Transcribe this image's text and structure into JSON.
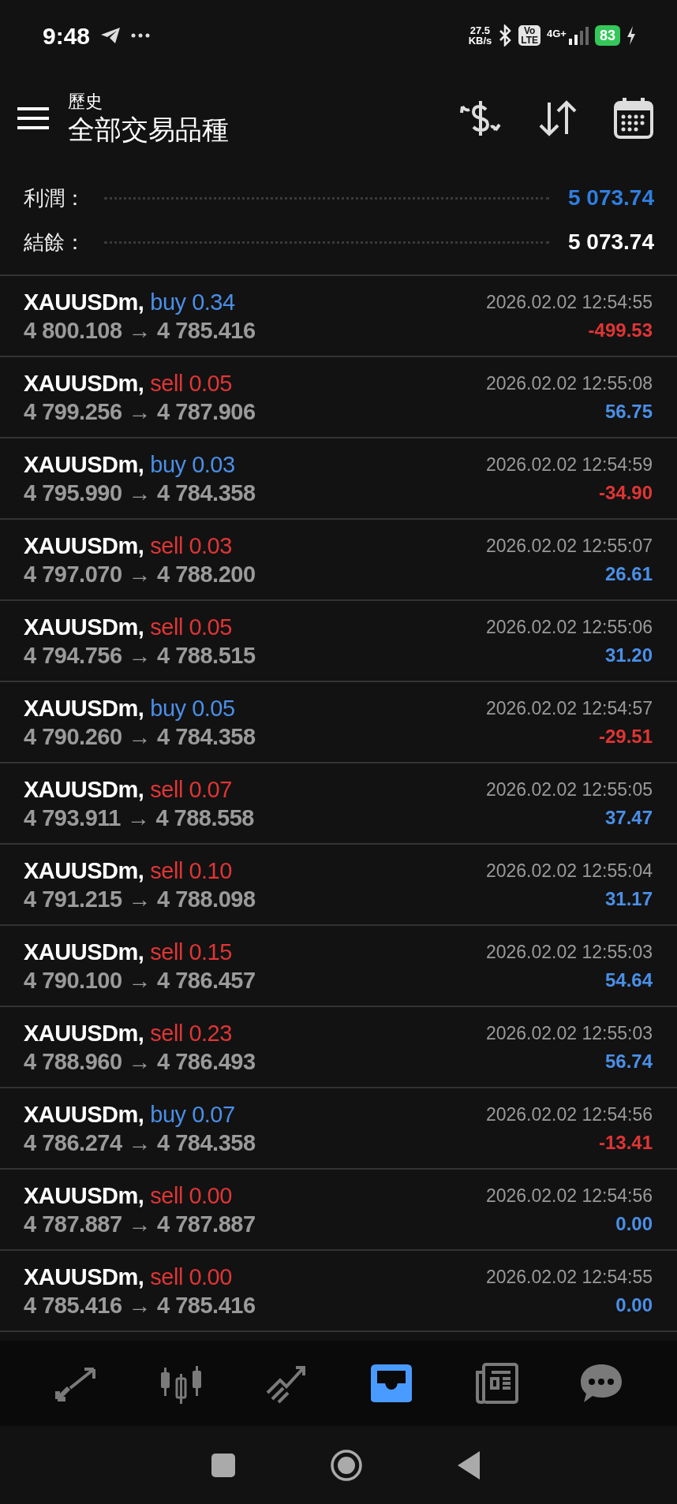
{
  "status_bar": {
    "time": "9:48",
    "net_speed": "27.5",
    "net_unit": "KB/s",
    "volte_top": "Vo",
    "volte_bottom": "LTE",
    "network": "4G+",
    "battery": "83"
  },
  "header": {
    "subtitle": "歷史",
    "title": "全部交易品種"
  },
  "summary": [
    {
      "label": "利潤：",
      "value": "5 073.74",
      "color": "#2f7fe0"
    },
    {
      "label": "結餘：",
      "value": "5 073.74",
      "color": "#ffffff"
    }
  ],
  "trades": [
    {
      "symbol": "XAUUSDm,",
      "side": "buy 0.34",
      "kind": "buy",
      "open": "4 800.108",
      "arrow": "→",
      "close": "4 785.416",
      "time": "2026.02.02 12:54:55",
      "profit": "-499.53",
      "color": "#e03535"
    },
    {
      "symbol": "XAUUSDm,",
      "side": "sell 0.05",
      "kind": "sell",
      "open": "4 799.256",
      "arrow": "→",
      "close": "4 787.906",
      "time": "2026.02.02 12:55:08",
      "profit": "56.75",
      "color": "#4a8fe8"
    },
    {
      "symbol": "XAUUSDm,",
      "side": "buy 0.03",
      "kind": "buy",
      "open": "4 795.990",
      "arrow": "→",
      "close": "4 784.358",
      "time": "2026.02.02 12:54:59",
      "profit": "-34.90",
      "color": "#e03535"
    },
    {
      "symbol": "XAUUSDm,",
      "side": "sell 0.03",
      "kind": "sell",
      "open": "4 797.070",
      "arrow": "→",
      "close": "4 788.200",
      "time": "2026.02.02 12:55:07",
      "profit": "26.61",
      "color": "#4a8fe8"
    },
    {
      "symbol": "XAUUSDm,",
      "side": "sell 0.05",
      "kind": "sell",
      "open": "4 794.756",
      "arrow": "→",
      "close": "4 788.515",
      "time": "2026.02.02 12:55:06",
      "profit": "31.20",
      "color": "#4a8fe8"
    },
    {
      "symbol": "XAUUSDm,",
      "side": "buy 0.05",
      "kind": "buy",
      "open": "4 790.260",
      "arrow": "→",
      "close": "4 784.358",
      "time": "2026.02.02 12:54:57",
      "profit": "-29.51",
      "color": "#e03535"
    },
    {
      "symbol": "XAUUSDm,",
      "side": "sell 0.07",
      "kind": "sell",
      "open": "4 793.911",
      "arrow": "→",
      "close": "4 788.558",
      "time": "2026.02.02 12:55:05",
      "profit": "37.47",
      "color": "#4a8fe8"
    },
    {
      "symbol": "XAUUSDm,",
      "side": "sell 0.10",
      "kind": "sell",
      "open": "4 791.215",
      "arrow": "→",
      "close": "4 788.098",
      "time": "2026.02.02 12:55:04",
      "profit": "31.17",
      "color": "#4a8fe8"
    },
    {
      "symbol": "XAUUSDm,",
      "side": "sell 0.15",
      "kind": "sell",
      "open": "4 790.100",
      "arrow": "→",
      "close": "4 786.457",
      "time": "2026.02.02 12:55:03",
      "profit": "54.64",
      "color": "#4a8fe8"
    },
    {
      "symbol": "XAUUSDm,",
      "side": "sell 0.23",
      "kind": "sell",
      "open": "4 788.960",
      "arrow": "→",
      "close": "4 786.493",
      "time": "2026.02.02 12:55:03",
      "profit": "56.74",
      "color": "#4a8fe8"
    },
    {
      "symbol": "XAUUSDm,",
      "side": "buy 0.07",
      "kind": "buy",
      "open": "4 786.274",
      "arrow": "→",
      "close": "4 784.358",
      "time": "2026.02.02 12:54:56",
      "profit": "-13.41",
      "color": "#e03535"
    },
    {
      "symbol": "XAUUSDm,",
      "side": "sell 0.00",
      "kind": "sell",
      "open": "4 787.887",
      "arrow": "→",
      "close": "4 787.887",
      "time": "2026.02.02 12:54:56",
      "profit": "0.00",
      "color": "#4a8fe8"
    },
    {
      "symbol": "XAUUSDm,",
      "side": "sell 0.00",
      "kind": "sell",
      "open": "4 785.416",
      "arrow": "→",
      "close": "4 785.416",
      "time": "2026.02.02 12:54:55",
      "profit": "0.00",
      "color": "#4a8fe8"
    }
  ],
  "bottom_nav": [
    {
      "kind": "quotes",
      "selected": false
    },
    {
      "kind": "chart",
      "selected": false
    },
    {
      "kind": "trade",
      "selected": false
    },
    {
      "kind": "history",
      "selected": true
    },
    {
      "kind": "news",
      "selected": false
    },
    {
      "kind": "chat",
      "selected": false
    }
  ]
}
